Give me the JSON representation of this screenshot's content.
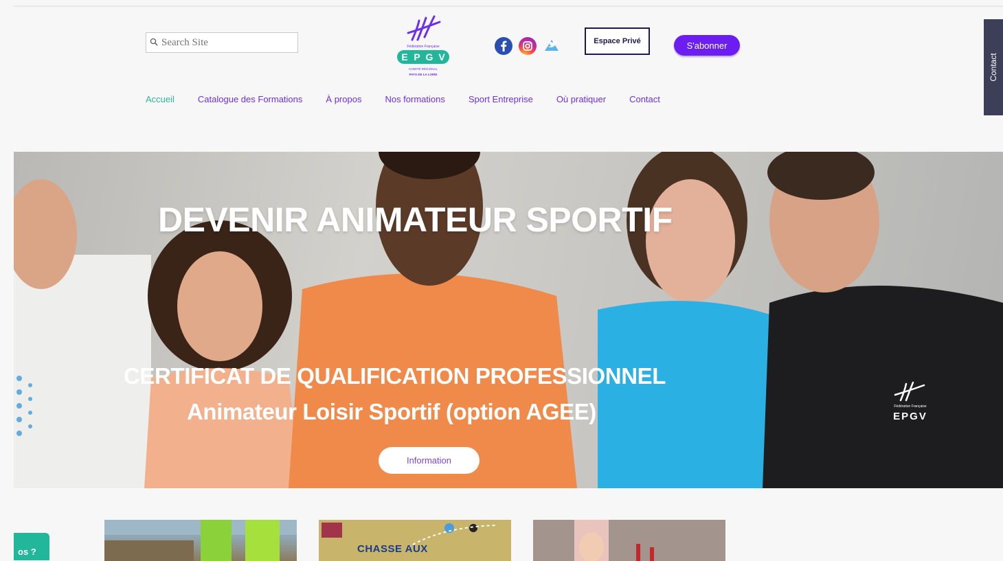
{
  "header": {
    "search": {
      "placeholder": "Search Site",
      "icon": "search-icon"
    },
    "logo": {
      "line1": "Fédération Française",
      "letters": [
        "E",
        "P",
        "G",
        "V"
      ],
      "line2": "COMITÉ RÉGIONAL",
      "line3": "PAYS DE LA LOIRE"
    },
    "socials": [
      {
        "name": "facebook-icon"
      },
      {
        "name": "instagram-icon"
      },
      {
        "name": "twitter-icon"
      }
    ],
    "espace_label": "Espace Privé",
    "subscribe_label": "S'abonner",
    "nav": [
      {
        "label": "Accueil",
        "active": true
      },
      {
        "label": "Catalogue des Formations"
      },
      {
        "label": "À propos"
      },
      {
        "label": "Nos formations"
      },
      {
        "label": "Sport Entreprise"
      },
      {
        "label": "Où pratiquer"
      },
      {
        "label": "Contact"
      }
    ]
  },
  "side_contact": "Contact",
  "hero": {
    "title": "DEVENIR ANIMATEUR SPORTIF",
    "subtitle_line1": "CERTIFICAT DE QUALIFICATION PROFESSIONNEL",
    "subtitle_line2": "Animateur Loisir Sportif (option AGEE)",
    "button_label": "Information",
    "shirt_logo_text": "Fédération Française",
    "shirt_logo_letters": "EPGV"
  },
  "chat_tab": "os ?",
  "cards": [
    {
      "text": ""
    },
    {
      "text": "CHASSE AUX"
    },
    {
      "text": ""
    }
  ],
  "colors": {
    "accent": "#6b1df2",
    "nav_link": "#6b2ff0",
    "nav_active": "#2bb79a",
    "dark": "#1e1850",
    "teal": "#22b79b"
  }
}
